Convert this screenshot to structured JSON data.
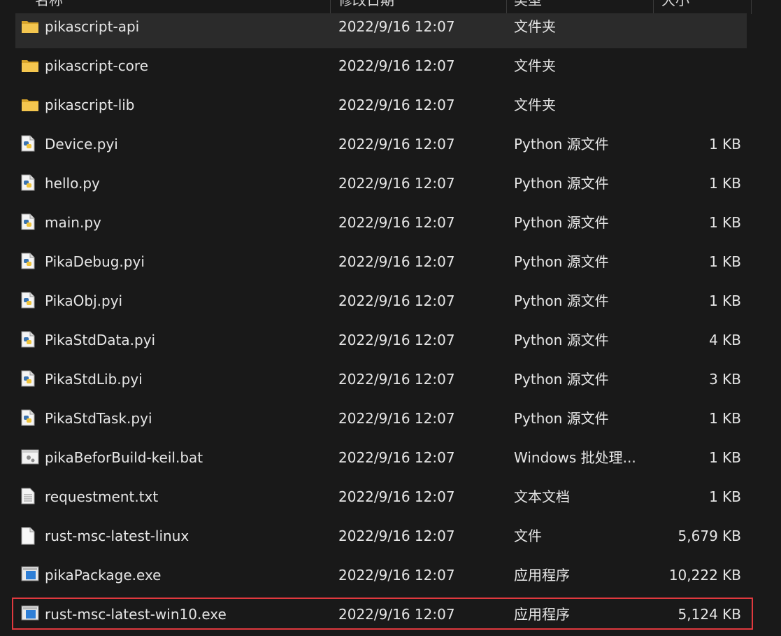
{
  "header": {
    "columns": [
      "名称",
      "修改日期",
      "类型",
      "大小"
    ]
  },
  "files": [
    {
      "name": "pikascript-api",
      "date": "2022/9/16 12:07",
      "type": "文件夹",
      "size": "",
      "icon": "folder-icon"
    },
    {
      "name": "pikascript-core",
      "date": "2022/9/16 12:07",
      "type": "文件夹",
      "size": "",
      "icon": "folder-icon"
    },
    {
      "name": "pikascript-lib",
      "date": "2022/9/16 12:07",
      "type": "文件夹",
      "size": "",
      "icon": "folder-icon"
    },
    {
      "name": "Device.pyi",
      "date": "2022/9/16 12:07",
      "type": "Python 源文件",
      "size": "1 KB",
      "icon": "python-file-icon"
    },
    {
      "name": "hello.py",
      "date": "2022/9/16 12:07",
      "type": "Python 源文件",
      "size": "1 KB",
      "icon": "python-file-icon"
    },
    {
      "name": "main.py",
      "date": "2022/9/16 12:07",
      "type": "Python 源文件",
      "size": "1 KB",
      "icon": "python-file-icon"
    },
    {
      "name": "PikaDebug.pyi",
      "date": "2022/9/16 12:07",
      "type": "Python 源文件",
      "size": "1 KB",
      "icon": "python-file-icon"
    },
    {
      "name": "PikaObj.pyi",
      "date": "2022/9/16 12:07",
      "type": "Python 源文件",
      "size": "1 KB",
      "icon": "python-file-icon"
    },
    {
      "name": "PikaStdData.pyi",
      "date": "2022/9/16 12:07",
      "type": "Python 源文件",
      "size": "4 KB",
      "icon": "python-file-icon"
    },
    {
      "name": "PikaStdLib.pyi",
      "date": "2022/9/16 12:07",
      "type": "Python 源文件",
      "size": "3 KB",
      "icon": "python-file-icon"
    },
    {
      "name": "PikaStdTask.pyi",
      "date": "2022/9/16 12:07",
      "type": "Python 源文件",
      "size": "1 KB",
      "icon": "python-file-icon"
    },
    {
      "name": "pikaBeforBuild-keil.bat",
      "date": "2022/9/16 12:07",
      "type": "Windows 批处理...",
      "size": "1 KB",
      "icon": "batch-file-icon"
    },
    {
      "name": "requestment.txt",
      "date": "2022/9/16 12:07",
      "type": "文本文档",
      "size": "1 KB",
      "icon": "text-file-icon"
    },
    {
      "name": "rust-msc-latest-linux",
      "date": "2022/9/16 12:07",
      "type": "文件",
      "size": "5,679 KB",
      "icon": "blank-file-icon"
    },
    {
      "name": "pikaPackage.exe",
      "date": "2022/9/16 12:07",
      "type": "应用程序",
      "size": "10,222 KB",
      "icon": "exe-file-icon"
    },
    {
      "name": "rust-msc-latest-win10.exe",
      "date": "2022/9/16 12:07",
      "type": "应用程序",
      "size": "5,124 KB",
      "icon": "exe-file-icon"
    }
  ],
  "colors": {
    "background": "#191919",
    "row_highlight": "#2b2b2b",
    "selection_outline": "#e0393e",
    "text": "#e6e6e6",
    "folder": "#f2c14e",
    "exe_blue": "#2f7fd6"
  }
}
